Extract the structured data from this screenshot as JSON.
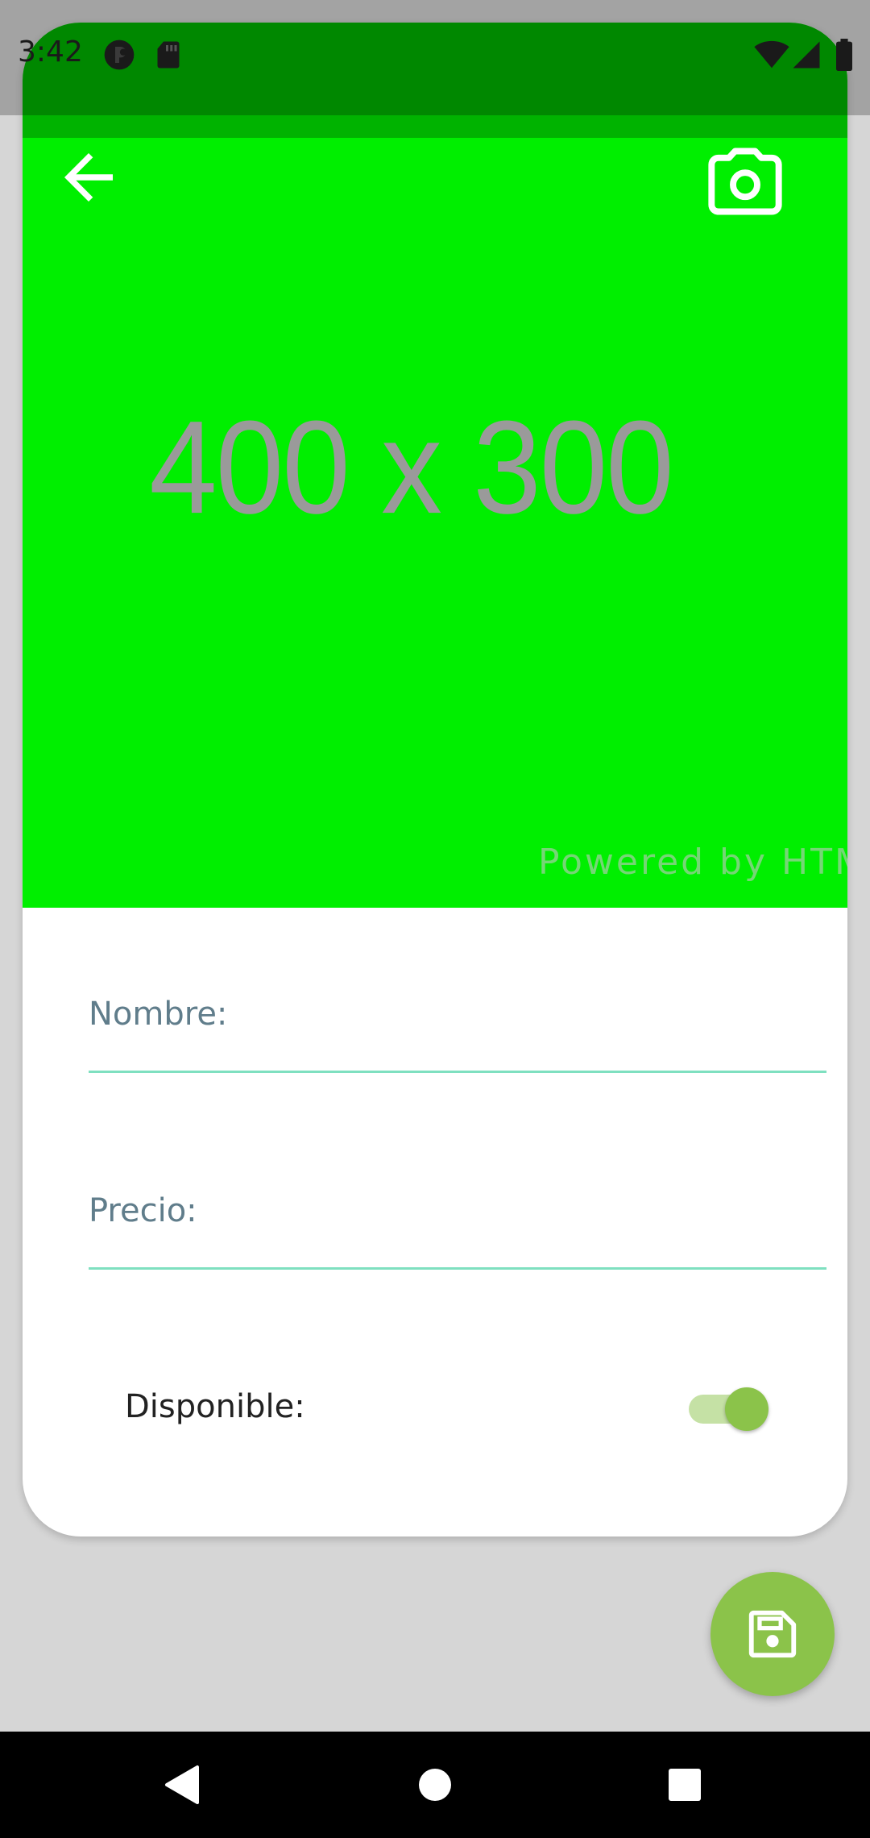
{
  "status_bar": {
    "time": "3:42",
    "icons": [
      "status-app-icon",
      "sd-card-icon",
      "wifi-icon",
      "signal-icon",
      "battery-icon"
    ]
  },
  "header": {
    "back_icon": "arrow-left-icon",
    "camera_icon": "camera-icon"
  },
  "image_placeholder": {
    "size_text": "400 x 300",
    "powered_text": "Powered by HTML",
    "background_color": "#00ef00"
  },
  "form": {
    "name_label": "Nombre:",
    "name_value": "",
    "price_label": "Precio:",
    "price_value": "",
    "available_label": "Disponible:",
    "available_on": true
  },
  "fab": {
    "icon": "save-icon",
    "color": "#8bc34a"
  },
  "nav_bar": {
    "icons": [
      "back-triangle-icon",
      "home-circle-icon",
      "recents-square-icon"
    ]
  },
  "colors": {
    "accent": "#8bc34a",
    "input_line": "#7fe0c0",
    "label": "#607d8b"
  }
}
